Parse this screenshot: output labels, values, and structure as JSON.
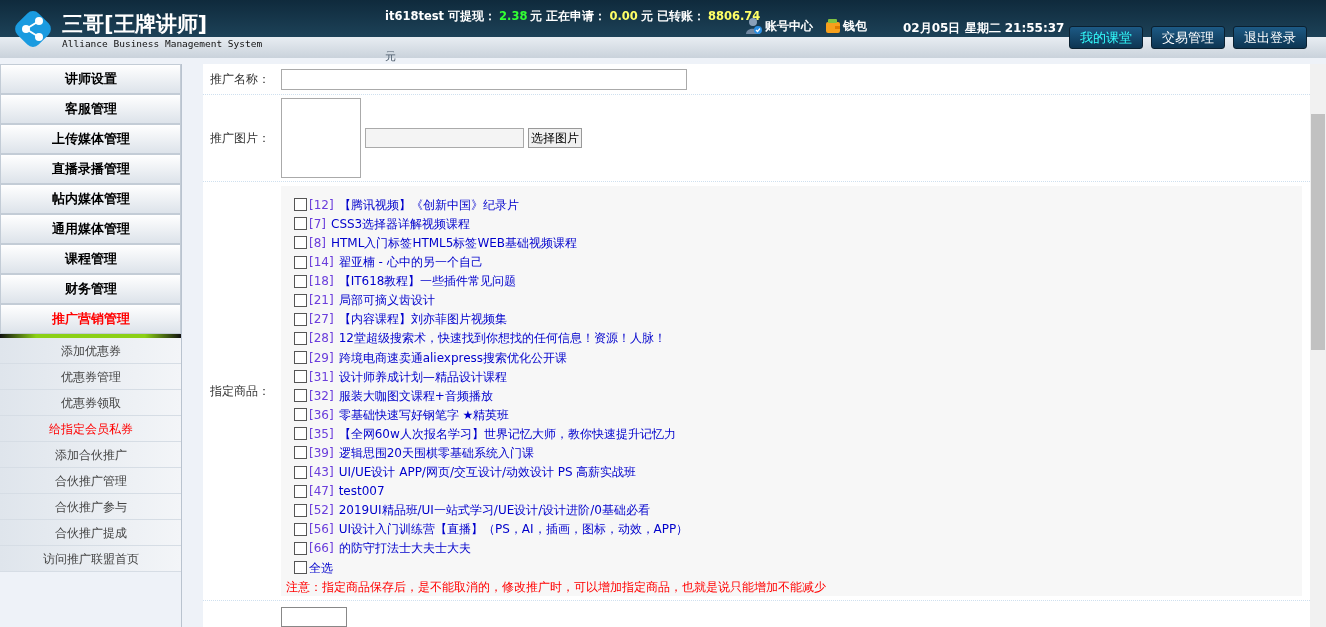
{
  "header": {
    "title": "三哥[王牌讲师]",
    "subtitle": "Alliance Business Management System",
    "stats": [
      {
        "text": "it618test 可提现：",
        "kind": "label"
      },
      {
        "text": "2.38",
        "kind": "green"
      },
      {
        "text": "元 正在申请：",
        "kind": "label"
      },
      {
        "text": "0.00",
        "kind": "yellow"
      },
      {
        "text": "元 已转账：",
        "kind": "label"
      },
      {
        "text": "8806.74",
        "kind": "yellow"
      }
    ],
    "stats_overflow": "元",
    "links": [
      {
        "label": "账号中心",
        "kind": "account"
      },
      {
        "label": "钱包",
        "kind": "wallet"
      }
    ],
    "datetime": "02月05日 星期二 21:55:37",
    "buttons": [
      {
        "label": "我的课堂",
        "selected": true
      },
      {
        "label": "交易管理",
        "selected": false
      },
      {
        "label": "退出登录",
        "selected": false
      }
    ]
  },
  "sidebar": {
    "items": [
      {
        "label": "讲师设置",
        "selected": false
      },
      {
        "label": "客服管理",
        "selected": false
      },
      {
        "label": "上传媒体管理",
        "selected": false
      },
      {
        "label": "直播录播管理",
        "selected": false
      },
      {
        "label": "帖内媒体管理",
        "selected": false
      },
      {
        "label": "通用媒体管理",
        "selected": false
      },
      {
        "label": "课程管理",
        "selected": false
      },
      {
        "label": "财务管理",
        "selected": false
      },
      {
        "label": "推广营销管理",
        "selected": true
      }
    ],
    "subitems": [
      {
        "label": "添加优惠券",
        "selected": false
      },
      {
        "label": "优惠券管理",
        "selected": false
      },
      {
        "label": "优惠券领取",
        "selected": false
      },
      {
        "label": "给指定会员私券",
        "selected": true
      },
      {
        "label": "添加合伙推广",
        "selected": false
      },
      {
        "label": "合伙推广管理",
        "selected": false
      },
      {
        "label": "合伙推广参与",
        "selected": false
      },
      {
        "label": "合伙推广提成",
        "selected": false
      },
      {
        "label": "访问推广联盟首页",
        "selected": false
      }
    ]
  },
  "form": {
    "name_label": "推广名称：",
    "image_label": "推广图片：",
    "image_button": "选择图片",
    "products_label": "指定商品：",
    "products": [
      {
        "id": "[12]",
        "title": "【腾讯视频】《创新中国》纪录片",
        "checked": false
      },
      {
        "id": "[7]",
        "title": "CSS3选择器详解视频课程",
        "checked": false
      },
      {
        "id": "[8]",
        "title": "HTML入门标签HTML5标签WEB基础视频课程",
        "checked": false
      },
      {
        "id": "[14]",
        "title": "翟亚楠 - 心中的另一个自己",
        "checked": false
      },
      {
        "id": "[18]",
        "title": "【IT618教程】一些插件常见问题",
        "checked": false
      },
      {
        "id": "[21]",
        "title": "局部可摘义齿设计",
        "checked": false
      },
      {
        "id": "[27]",
        "title": "【内容课程】刘亦菲图片视频集",
        "checked": false
      },
      {
        "id": "[28]",
        "title": "12堂超级搜索术，快速找到你想找的任何信息！资源！人脉！",
        "checked": false
      },
      {
        "id": "[29]",
        "title": "跨境电商速卖通aliexpress搜索优化公开课",
        "checked": false
      },
      {
        "id": "[31]",
        "title": "设计师养成计划—精品设计课程",
        "checked": false
      },
      {
        "id": "[32]",
        "title": "服装大咖图文课程+音频播放",
        "checked": false
      },
      {
        "id": "[36]",
        "title": "零基础快速写好钢笔字 ★精英班",
        "checked": false
      },
      {
        "id": "[35]",
        "title": "【全网60w人次报名学习】世界记忆大师，教你快速提升记忆力",
        "checked": false
      },
      {
        "id": "[39]",
        "title": "逻辑思围20天围棋零基础系统入门课",
        "checked": false
      },
      {
        "id": "[43]",
        "title": "UI/UE设计 APP/网页/交互设计/动效设计 PS 高薪实战班",
        "checked": false
      },
      {
        "id": "[47]",
        "title": "test007",
        "checked": false
      },
      {
        "id": "[52]",
        "title": "2019UI精品班/UI一站式学习/UE设计/设计进阶/0基础必看",
        "checked": false
      },
      {
        "id": "[56]",
        "title": "UI设计入门训练营【直播】（PS，AI，插画，图标，动效，APP）",
        "checked": false
      },
      {
        "id": "[66]",
        "title": "的防守打法士大夫士大夫",
        "checked": false
      }
    ],
    "select_all": {
      "label": "全选",
      "checked": false
    },
    "note": "注意：指定商品保存后，是不能取消的，修改推广时，可以增加指定商品，也就是说只能增加不能减少"
  }
}
